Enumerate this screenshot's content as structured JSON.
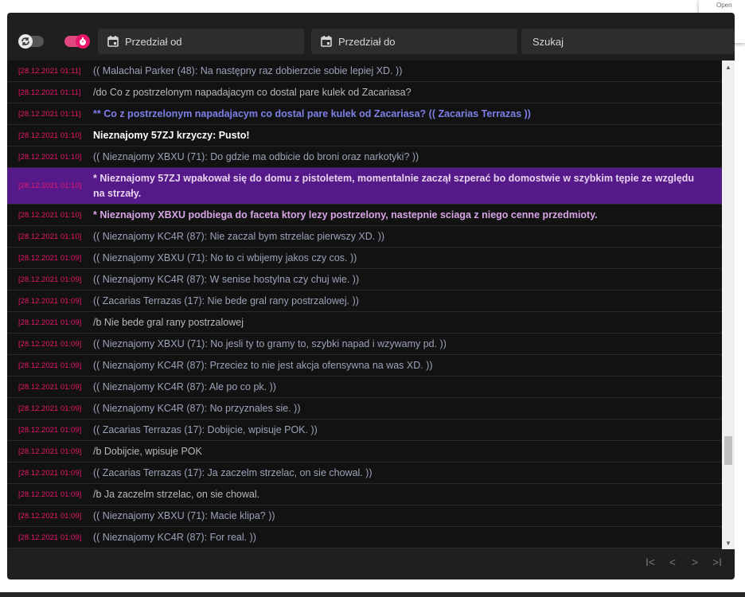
{
  "popup": {
    "text": "Open"
  },
  "toolbar": {
    "date_from_label": "Przedział od",
    "date_to_label": "Przedział do",
    "search_placeholder": "Szukaj"
  },
  "colors": {
    "accent": "#e8176a",
    "highlight_row": "#56198a",
    "panel_bg": "#1f1f1f"
  },
  "chat": {
    "rows": [
      {
        "ts": "[28.12.2021 01:11]",
        "msg": "(( Malachai Parker (48): Na następny raz dobierzcie sobie lepiej XD. ))",
        "kind": "ooc"
      },
      {
        "ts": "[28.12.2021 01:11]",
        "msg": "/do Co z postrzelonym napadajacym co dostal pare kulek od Zacariasa?",
        "kind": "do"
      },
      {
        "ts": "[28.12.2021 01:11]",
        "msg": "** Co z postrzelonym napadajacym co dostal pare kulek od Zacariasa? (( Zacarias Terrazas ))",
        "kind": "low"
      },
      {
        "ts": "[28.12.2021 01:10]",
        "msg": "Nieznajomy 57ZJ krzyczy: Pusto!",
        "kind": "shout"
      },
      {
        "ts": "[28.12.2021 01:10]",
        "msg": "(( Nieznajomy XBXU (71): Do gdzie ma odbicie do broni oraz narkotyki? ))",
        "kind": "ooc"
      },
      {
        "ts": "[28.12.2021 01:10]",
        "msg": "* Nieznajomy 57ZJ wpakował się do domu z pistoletem, momentalnie zaczął szperać bo domostwie w szybkim tępie ze względu na strzały.",
        "kind": "me-hl"
      },
      {
        "ts": "[28.12.2021 01:10]",
        "msg": "* Nieznajomy XBXU podbiega do faceta ktory lezy postrzelony, nastepnie sciaga z niego cenne przedmioty.",
        "kind": "me"
      },
      {
        "ts": "[28.12.2021 01:10]",
        "msg": "(( Nieznajomy KC4R (87): Nie zaczal bym strzelac pierwszy XD. ))",
        "kind": "ooc"
      },
      {
        "ts": "[28.12.2021 01:09]",
        "msg": "(( Nieznajomy XBXU (71): No to ci wbijemy jakos czy cos. ))",
        "kind": "ooc"
      },
      {
        "ts": "[28.12.2021 01:09]",
        "msg": "(( Nieznajomy KC4R (87): W senise hostylna czy chuj wie. ))",
        "kind": "ooc"
      },
      {
        "ts": "[28.12.2021 01:09]",
        "msg": "(( Zacarias Terrazas (17): Nie bede gral rany postrzalowej. ))",
        "kind": "ooc"
      },
      {
        "ts": "[28.12.2021 01:09]",
        "msg": "/b Nie bede gral rany postrzalowej",
        "kind": "b"
      },
      {
        "ts": "[28.12.2021 01:09]",
        "msg": "(( Nieznajomy XBXU (71): No jesli ty to gramy to, szybki napad i wzywamy pd. ))",
        "kind": "ooc"
      },
      {
        "ts": "[28.12.2021 01:09]",
        "msg": "(( Nieznajomy KC4R (87): Przeciez to nie jest akcja ofensywna na was XD. ))",
        "kind": "ooc"
      },
      {
        "ts": "[28.12.2021 01:09]",
        "msg": "(( Nieznajomy KC4R (87): Ale po co pk. ))",
        "kind": "ooc"
      },
      {
        "ts": "[28.12.2021 01:09]",
        "msg": "(( Nieznajomy KC4R (87): No przyznales sie. ))",
        "kind": "ooc"
      },
      {
        "ts": "[28.12.2021 01:09]",
        "msg": "(( Zacarias Terrazas (17): Dobijcie, wpisuje POK. ))",
        "kind": "ooc"
      },
      {
        "ts": "[28.12.2021 01:09]",
        "msg": "/b Dobijcie, wpisuje POK",
        "kind": "b"
      },
      {
        "ts": "[28.12.2021 01:09]",
        "msg": "(( Zacarias Terrazas (17): Ja zaczelm strzelac, on sie chowal. ))",
        "kind": "ooc"
      },
      {
        "ts": "[28.12.2021 01:09]",
        "msg": "/b Ja zaczelm strzelac, on sie chowal.",
        "kind": "b"
      },
      {
        "ts": "[28.12.2021 01:09]",
        "msg": "(( Nieznajomy XBXU (71): Macie klipa? ))",
        "kind": "ooc"
      },
      {
        "ts": "[28.12.2021 01:09]",
        "msg": "(( Nieznajomy KC4R (87): For real. ))",
        "kind": "ooc"
      }
    ]
  },
  "pager": {
    "first": "I<",
    "prev": "<",
    "next": ">",
    "last": ">I"
  }
}
